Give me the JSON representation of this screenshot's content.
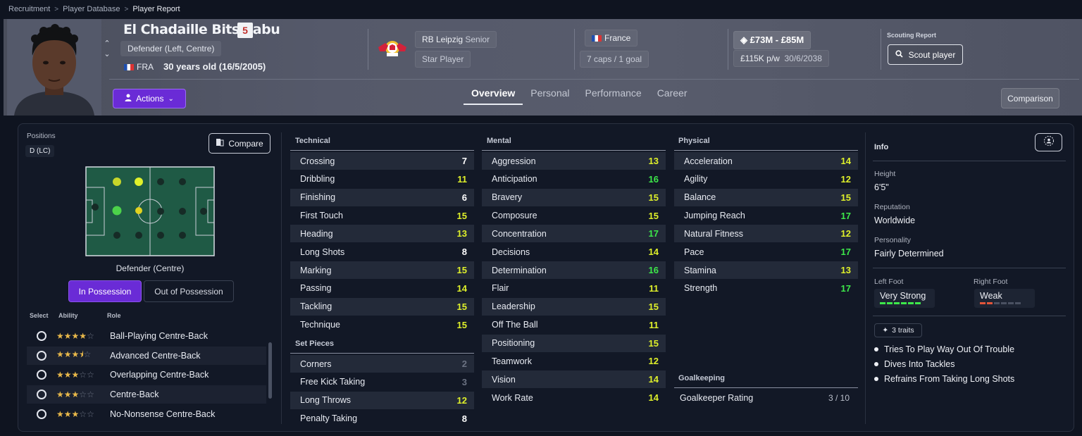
{
  "breadcrumb": [
    "Recruitment",
    "Player Database",
    "Player Report"
  ],
  "player": {
    "name": "El Chadaille Bitshiabu",
    "number": "5",
    "position": "Defender (Left, Centre)",
    "nation_code": "FRA",
    "age_text": "30 years old (16/5/2005)"
  },
  "club": {
    "name": "RB Leipzig",
    "squad": "Senior",
    "status": "Star Player"
  },
  "nation": {
    "name": "France",
    "caps": "7 caps / 1 goal"
  },
  "contract": {
    "value": "£73M - £85M",
    "wage": "£115K p/w",
    "expiry": "30/6/2038"
  },
  "scouting": {
    "label": "Scouting Report",
    "button": "Scout player"
  },
  "actions_label": "Actions",
  "tabs": [
    "Overview",
    "Personal",
    "Performance",
    "Career"
  ],
  "comparison_label": "Comparison",
  "positions": {
    "label": "Positions",
    "chip": "D (LC)",
    "compare_label": "Compare",
    "pitch_label": "Defender (Centre)",
    "toggle_on": "In Possession",
    "toggle_off": "Out of Possession"
  },
  "roles_head": {
    "select": "Select",
    "ability": "Ability",
    "role": "Role"
  },
  "roles": [
    {
      "name": "Ball-Playing Centre-Back",
      "stars": 4
    },
    {
      "name": "Advanced Centre-Back",
      "stars": 3.5
    },
    {
      "name": "Overlapping Centre-Back",
      "stars": 3
    },
    {
      "name": "Centre-Back",
      "stars": 3
    },
    {
      "name": "No-Nonsense Centre-Back",
      "stars": 3
    }
  ],
  "technical": {
    "title": "Technical",
    "attrs": [
      {
        "name": "Crossing",
        "value": "7"
      },
      {
        "name": "Dribbling",
        "value": "11"
      },
      {
        "name": "Finishing",
        "value": "6"
      },
      {
        "name": "First Touch",
        "value": "15"
      },
      {
        "name": "Heading",
        "value": "13"
      },
      {
        "name": "Long Shots",
        "value": "8"
      },
      {
        "name": "Marking",
        "value": "15"
      },
      {
        "name": "Passing",
        "value": "14"
      },
      {
        "name": "Tackling",
        "value": "15"
      },
      {
        "name": "Technique",
        "value": "15"
      }
    ]
  },
  "set_pieces": {
    "title": "Set Pieces",
    "attrs": [
      {
        "name": "Corners",
        "value": "2"
      },
      {
        "name": "Free Kick Taking",
        "value": "3"
      },
      {
        "name": "Long Throws",
        "value": "12"
      },
      {
        "name": "Penalty Taking",
        "value": "8"
      }
    ]
  },
  "mental": {
    "title": "Mental",
    "attrs": [
      {
        "name": "Aggression",
        "value": "13"
      },
      {
        "name": "Anticipation",
        "value": "16"
      },
      {
        "name": "Bravery",
        "value": "15"
      },
      {
        "name": "Composure",
        "value": "15"
      },
      {
        "name": "Concentration",
        "value": "17"
      },
      {
        "name": "Decisions",
        "value": "14"
      },
      {
        "name": "Determination",
        "value": "16"
      },
      {
        "name": "Flair",
        "value": "11"
      },
      {
        "name": "Leadership",
        "value": "15"
      },
      {
        "name": "Off The Ball",
        "value": "11"
      },
      {
        "name": "Positioning",
        "value": "15"
      },
      {
        "name": "Teamwork",
        "value": "12"
      },
      {
        "name": "Vision",
        "value": "14"
      },
      {
        "name": "Work Rate",
        "value": "14"
      }
    ]
  },
  "physical": {
    "title": "Physical",
    "attrs": [
      {
        "name": "Acceleration",
        "value": "14"
      },
      {
        "name": "Agility",
        "value": "12"
      },
      {
        "name": "Balance",
        "value": "15"
      },
      {
        "name": "Jumping Reach",
        "value": "17"
      },
      {
        "name": "Natural Fitness",
        "value": "12"
      },
      {
        "name": "Pace",
        "value": "17"
      },
      {
        "name": "Stamina",
        "value": "13"
      },
      {
        "name": "Strength",
        "value": "17"
      }
    ]
  },
  "goalkeeping": {
    "title": "Goalkeeping",
    "label": "Goalkeeper Rating",
    "value": "3 / 10"
  },
  "info": {
    "title": "Info",
    "height_label": "Height",
    "height": "6'5\"",
    "reputation_label": "Reputation",
    "reputation": "Worldwide",
    "personality_label": "Personality",
    "personality": "Fairly Determined",
    "left_foot_label": "Left Foot",
    "left_foot": "Very Strong",
    "left_foot_level": 6,
    "right_foot_label": "Right Foot",
    "right_foot": "Weak",
    "right_foot_level": 2,
    "traits_label": "3 traits",
    "traits": [
      "Tries To Play Way Out Of Trouble",
      "Dives Into Tackles",
      "Refrains From Taking Long Shots"
    ]
  }
}
